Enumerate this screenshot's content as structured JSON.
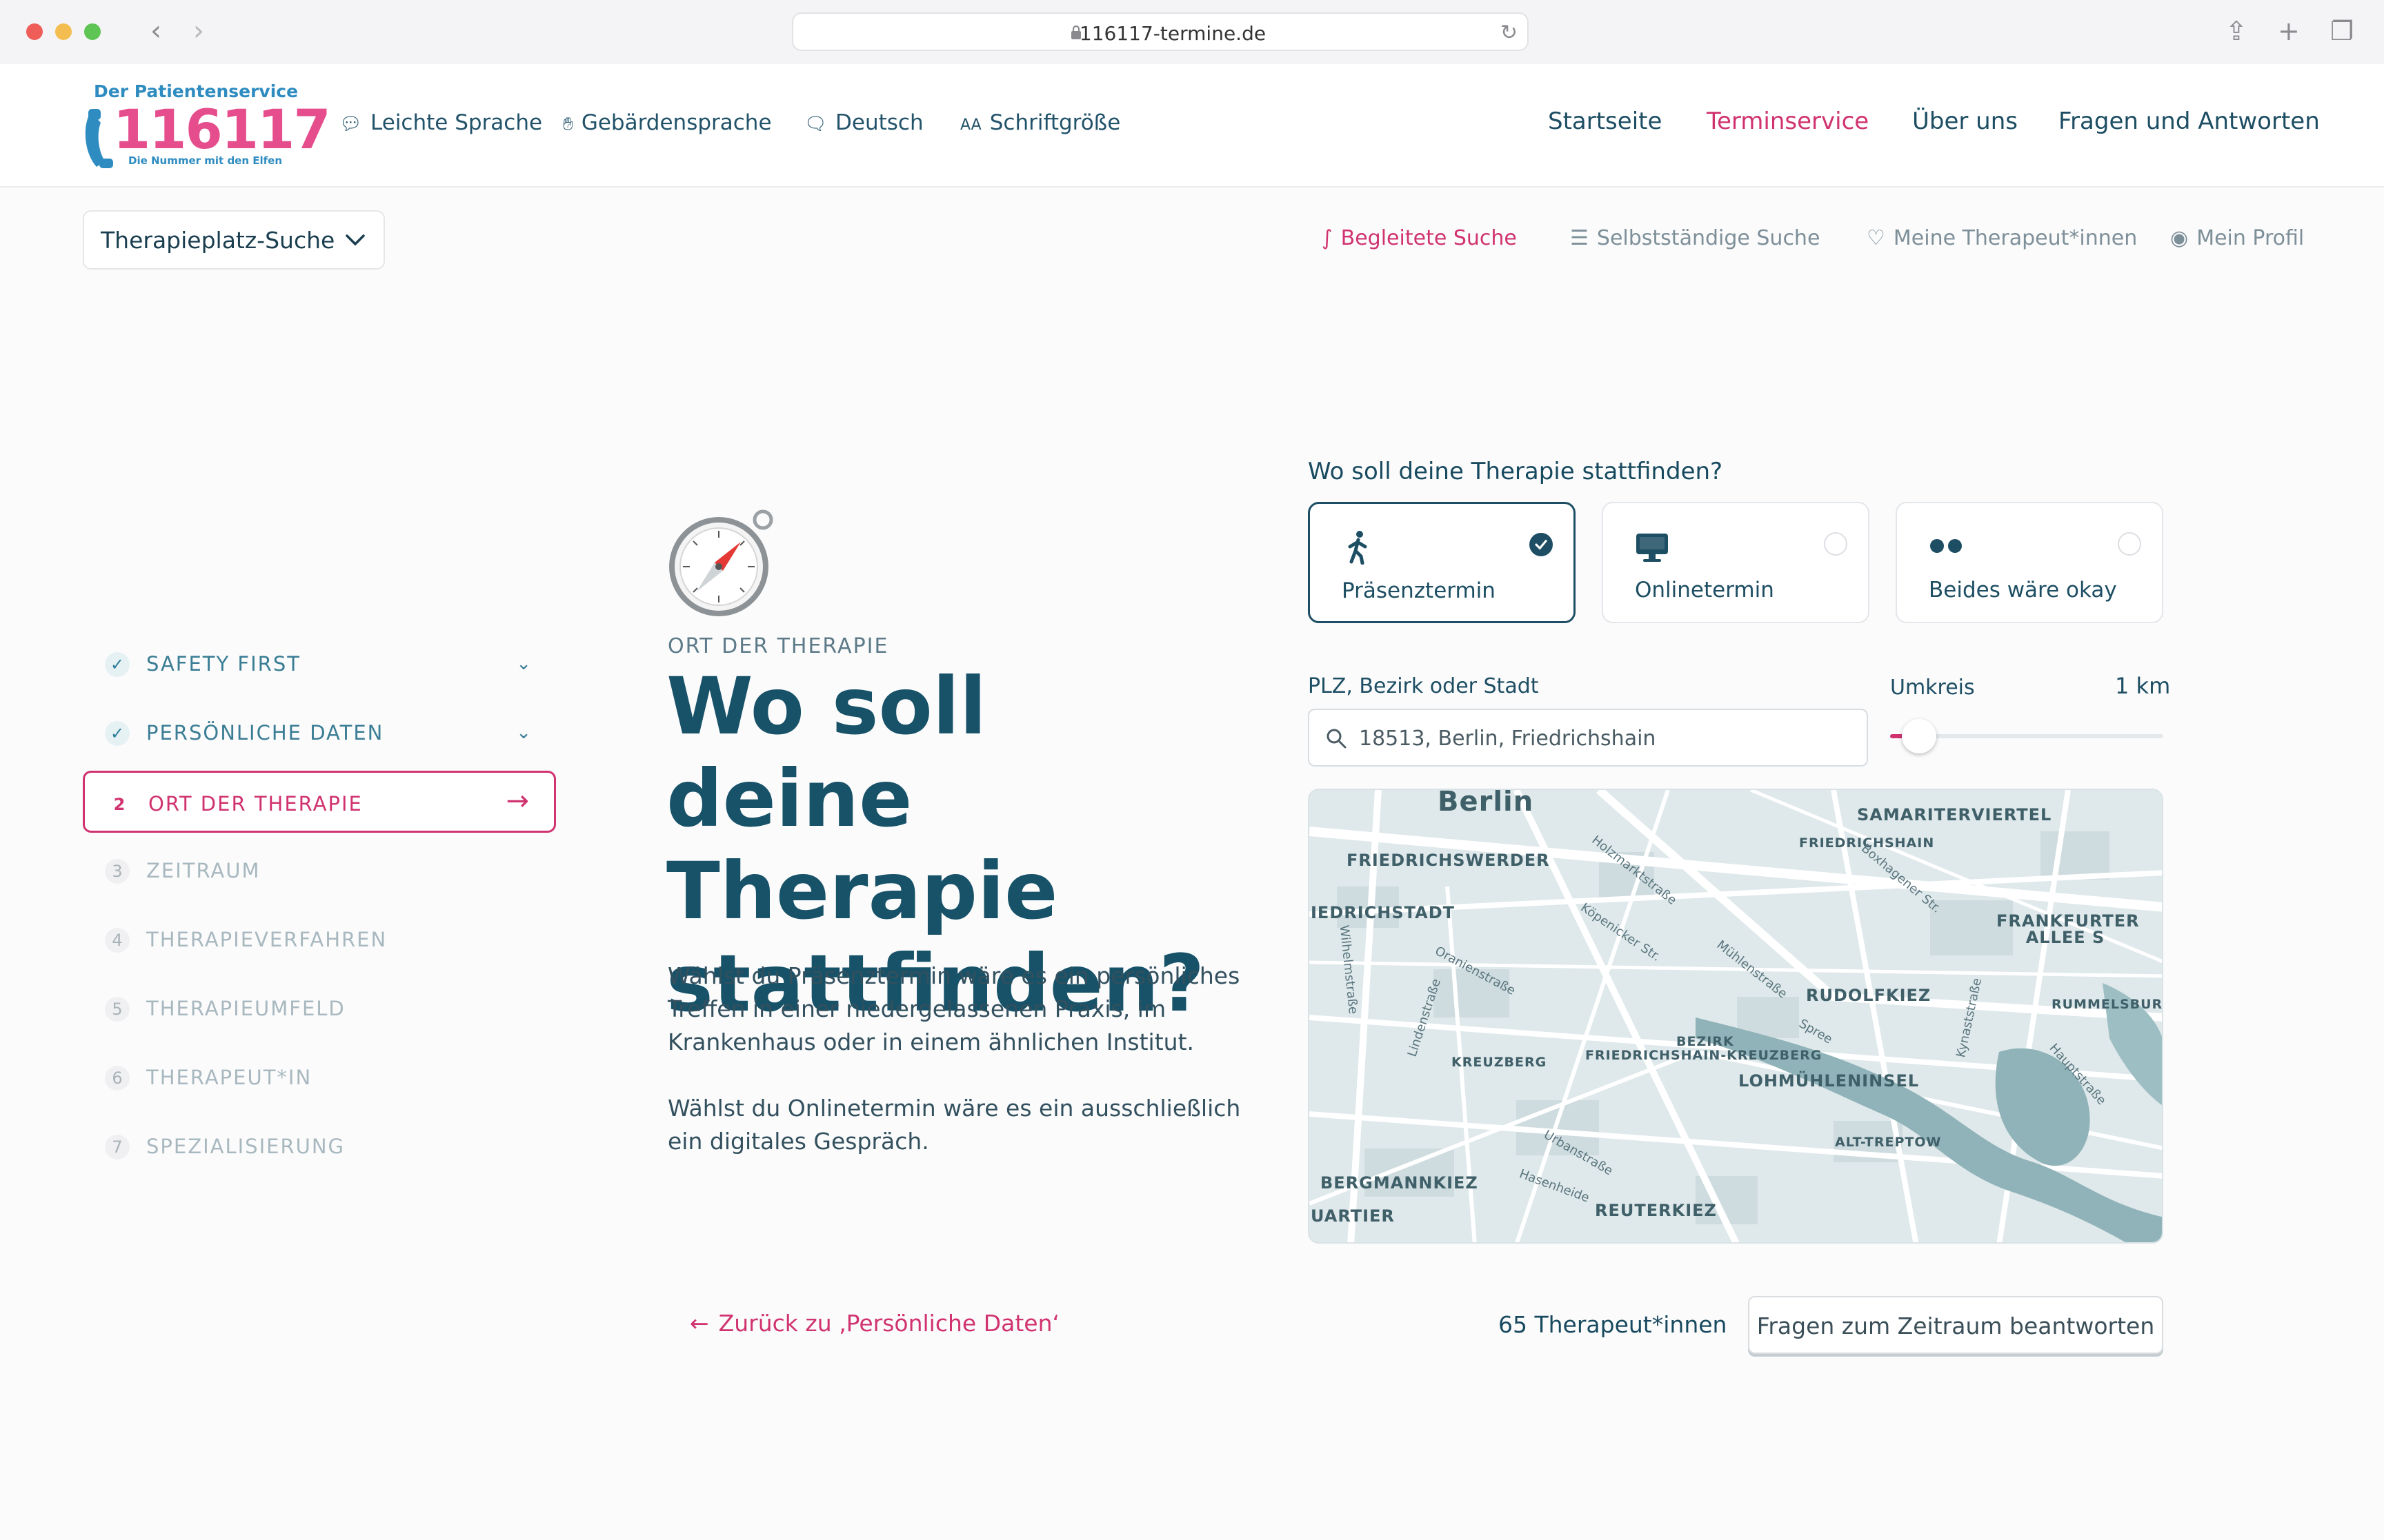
{
  "browser": {
    "url": "116117-termine.de"
  },
  "logo": {
    "top": "Der Patientenservice",
    "number": "116117",
    "sub": "Die Nummer mit den Elfen"
  },
  "utility_nav": [
    {
      "label": "Leichte Sprache",
      "icon": "speech-bubble-icon"
    },
    {
      "label": "Gebärdensprache",
      "icon": "hand-icon"
    },
    {
      "label": "Deutsch",
      "icon": "chat-bubbles-icon"
    },
    {
      "label": "Schriftgröße",
      "icon": "font-size-icon",
      "glyph": "AA"
    }
  ],
  "main_nav": [
    {
      "label": "Startseite",
      "active": false
    },
    {
      "label": "Terminservice",
      "active": true
    },
    {
      "label": "Über uns",
      "active": false
    },
    {
      "label": "Fragen und Antworten",
      "active": false
    }
  ],
  "selector": {
    "label": "Therapieplatz-Suche"
  },
  "sub_nav": [
    {
      "label": "Begleitete Suche",
      "icon": "route-icon",
      "active": true
    },
    {
      "label": "Selbstständige Suche",
      "icon": "sliders-icon",
      "active": false
    },
    {
      "label": "Meine Therapeut*innen",
      "icon": "heart-icon",
      "active": false
    },
    {
      "label": "Mein Profil",
      "icon": "user-circle-icon",
      "active": false
    }
  ],
  "steps": [
    {
      "num": "✓",
      "label": "SAFETY FIRST",
      "state": "done"
    },
    {
      "num": "✓",
      "label": "PERSÖNLICHE DATEN",
      "state": "done"
    },
    {
      "num": "2",
      "label": "ORT DER THERAPIE",
      "state": "current"
    },
    {
      "num": "3",
      "label": "ZEITRAUM",
      "state": "todo"
    },
    {
      "num": "4",
      "label": "THERAPIEVERFAHREN",
      "state": "todo"
    },
    {
      "num": "5",
      "label": "THERAPIEUMFELD",
      "state": "todo"
    },
    {
      "num": "6",
      "label": "THERAPEUT*IN",
      "state": "todo"
    },
    {
      "num": "7",
      "label": "SPEZIALISIERUNG",
      "state": "todo"
    }
  ],
  "content": {
    "eyebrow": "ORT DER THERAPIE",
    "headline": "Wo soll deine Therapie stattfinden?",
    "para1": "Wählst du Präsenztermin wäre es ein persönliches Treffen in einer niedergelassenen Praxis, im Krankenhaus oder in einem ähnlichen Institut.",
    "para2": "Wählst du Onlinetermin wäre es ein ausschließlich ein digitales Gespräch."
  },
  "form": {
    "question": "Wo soll deine Therapie stattfinden?",
    "options": [
      {
        "label": "Präsenztermin",
        "icon": "walking-person-icon",
        "selected": true
      },
      {
        "label": "Onlinetermin",
        "icon": "monitor-icon",
        "selected": false
      },
      {
        "label": "Beides wäre okay",
        "icon": "two-dots-icon",
        "selected": false
      }
    ],
    "location_label": "PLZ, Bezirk oder Stadt",
    "location_value": "18513, Berlin, Friedrichshain",
    "radius_label": "Umkreis",
    "radius_value": "1 km",
    "radius_fraction": 0.02
  },
  "map": {
    "districts": [
      "Berlin",
      "SAMARITERVIERTEL",
      "FRIEDRICHSHAIN",
      "FRIEDRICHSWERDER",
      "IEDRICHSTADT",
      "FRANKFURTER ALLEE S",
      "RUDOLFKIEZ",
      "RUMMELSBURG",
      "KREUZBERG",
      "BEZIRK",
      "FRIEDRICHSHAIN-KREUZBERG",
      "LOHMÜHLENINSEL",
      "ALT-TREPTOW",
      "BERGMANNKIEZ",
      "UARTIER",
      "REUTERKIEZ"
    ],
    "streets": [
      "Holzmarktstraße",
      "Köpenicker Str.",
      "Oranienstraße",
      "Mühlenstraße",
      "Boxhagener Str.",
      "Wilhelmstraße",
      "Lindenstraße",
      "Urbanstraße",
      "Hasenheide",
      "Kynaststraße",
      "Hauptstraße",
      "Spree"
    ]
  },
  "footer": {
    "back": "Zurück zu ‚Persönliche Daten‘",
    "count": "65 Therapeut*innen",
    "next": "Fragen zum Zeitraum  beantworten"
  },
  "colors": {
    "accent": "#d0336f",
    "primary": "#1d4e63",
    "logo_blue": "#2e8cc0",
    "logo_pink": "#e54d8d"
  }
}
